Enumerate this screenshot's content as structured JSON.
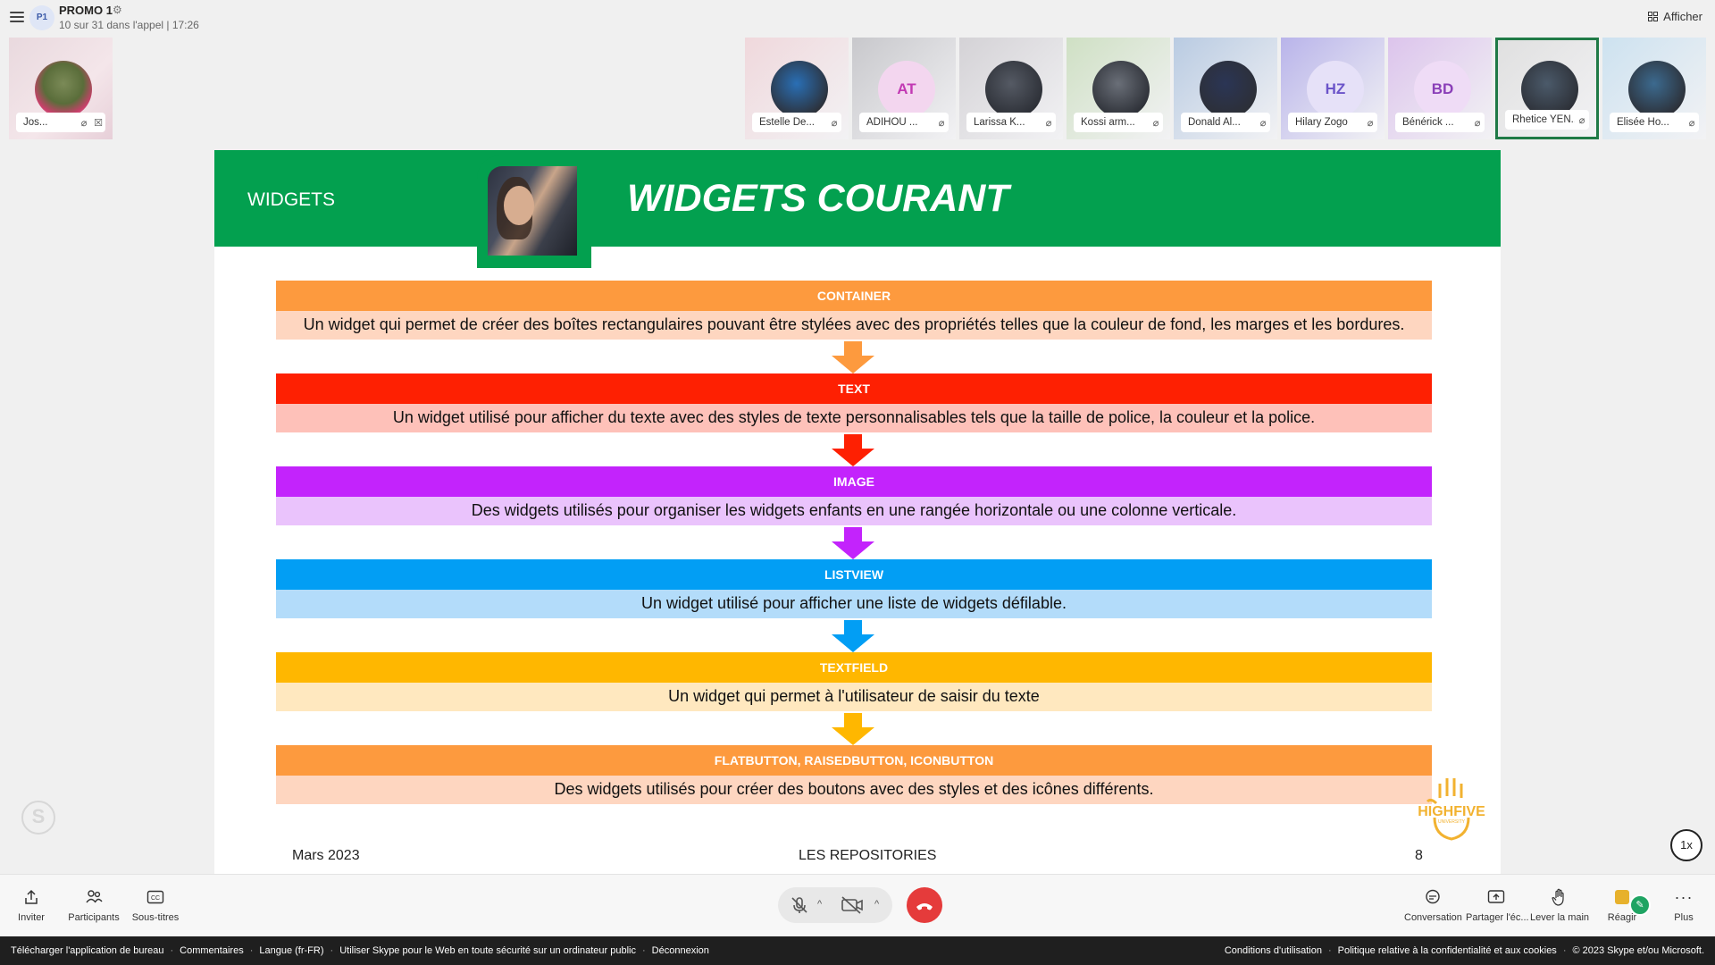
{
  "topbar": {
    "group_initials": "P1",
    "title": "PROMO 1",
    "subtitle": "10 sur 31 dans l'appel | 17:26",
    "view_button": "Afficher"
  },
  "self_tile": {
    "name": "Jos...",
    "avatar_color": "#d6b4c4"
  },
  "participants": [
    {
      "name": "Estelle De...",
      "initials": "",
      "bg": "#f0d8dc",
      "avatar_color": "#2a6fb5"
    },
    {
      "name": "ADIHOU ...",
      "initials": "AT",
      "bg": "#c8c8cc",
      "avatar_color": "#f3d6ef",
      "initials_color": "#c239b3"
    },
    {
      "name": "Larissa K...",
      "initials": "",
      "bg": "#d4d2d6",
      "avatar_color": "#555a64"
    },
    {
      "name": "Kossi arm...",
      "initials": "",
      "bg": "#cfe0c4",
      "avatar_color": "#6a6f78"
    },
    {
      "name": "Donald Al...",
      "initials": "",
      "bg": "#b9cbe2",
      "avatar_color": "#2b3555"
    },
    {
      "name": "Hilary Zogo",
      "initials": "HZ",
      "bg": "#b9b4ea",
      "avatar_color": "#e6e1f8",
      "initials_color": "#6b54c9"
    },
    {
      "name": "Bénérick ...",
      "initials": "BD",
      "bg": "#dcc4ec",
      "avatar_color": "#efdcf6",
      "initials_color": "#8a3fb8"
    },
    {
      "name": "Rhetice YEN...",
      "initials": "",
      "bg": "#e0e0e0",
      "avatar_color": "#4b5a6a",
      "active": true
    },
    {
      "name": "Elisée Ho...",
      "initials": "",
      "bg": "#cde2f0",
      "avatar_color": "#3c6a8f"
    }
  ],
  "slide": {
    "section": "WIDGETS",
    "title": "WIDGETS COURANT",
    "steps": [
      {
        "title": "CONTAINER",
        "text": "Un widget qui permet de créer des boîtes rectangulaires pouvant être stylées avec des propriétés telles que la couleur de fond, les marges et les bordures.",
        "color": "#fd9a3e",
        "light": "#fed6c0"
      },
      {
        "title": "TEXT",
        "text": "Un widget utilisé pour afficher du texte avec des styles de texte personnalisables tels que la taille de police, la couleur et la police.",
        "color": "#fe2002",
        "light": "#fec1b9"
      },
      {
        "title": "IMAGE",
        "text": "Des widgets utilisés pour organiser les widgets enfants en une rangée horizontale ou une colonne verticale.",
        "color": "#c323fc",
        "light": "#eac3fc"
      },
      {
        "title": "LISTVIEW",
        "text": "Un widget utilisé pour afficher une liste de widgets défilable.",
        "color": "#029ef4",
        "light": "#b3dcfa"
      },
      {
        "title": "TEXTFIELD",
        "text": "Un widget qui permet à l'utilisateur de saisir du texte",
        "color": "#ffb700",
        "light": "#ffe8bf"
      },
      {
        "title": "FLATBUTTON, RAISEDBUTTON, ICONBUTTON",
        "text": "Des widgets utilisés pour créer des boutons avec des styles et des icônes différents.",
        "color": "#fd9a3e",
        "light": "#fed6c0"
      }
    ],
    "footer_left": "Mars 2023",
    "footer_center": "LES REPOSITORIES",
    "footer_right": "8",
    "logo_text": "HIGHFIVE",
    "logo_sub": "UNIVERSITY"
  },
  "speed": "1x",
  "toolbar": {
    "invite": "Inviter",
    "participants": "Participants",
    "captions": "Sous-titres",
    "conversation": "Conversation",
    "share": "Partager l'éc...",
    "raise_hand": "Lever la main",
    "react": "Réagir",
    "more": "Plus"
  },
  "footer": {
    "left": [
      "Télécharger l'application de bureau",
      "Commentaires",
      "Langue (fr-FR)",
      "Utiliser Skype pour le Web en toute sécurité sur un ordinateur public",
      "Déconnexion"
    ],
    "right": [
      "Conditions d'utilisation",
      "Politique relative à la confidentialité et aux cookies",
      "© 2023 Skype et/ou Microsoft."
    ]
  }
}
